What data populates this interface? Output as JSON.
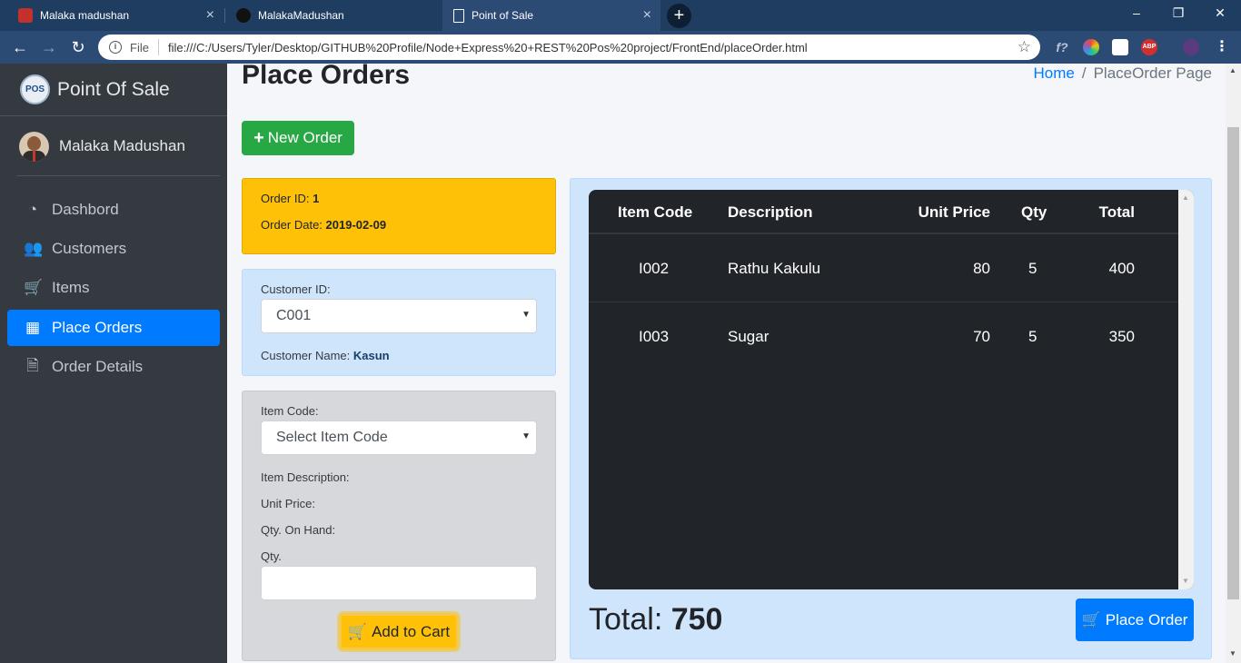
{
  "browser": {
    "tabs": [
      {
        "title": "Malaka madushan",
        "favicon": "red-mascot-icon"
      },
      {
        "title": "MalakaMadushan",
        "favicon": "github-icon"
      },
      {
        "title": "Point of Sale",
        "favicon": "page-icon"
      }
    ],
    "address": {
      "scheme_label": "File",
      "url": "file:///C:/Users/Tyler/Desktop/GITHUB%20Profile/Node+Express%20+REST%20Pos%20project/FrontEnd/placeOrder.html"
    },
    "extensions": [
      "f?",
      "color-wheel-icon",
      "glasses-icon",
      "ABP",
      "profile-avatar"
    ]
  },
  "sidebar": {
    "brand": "Point Of Sale",
    "brand_logo": "POS",
    "user": "Malaka Madushan",
    "items": [
      {
        "label": "Dashbord",
        "icon": "tachometer-icon"
      },
      {
        "label": "Customers",
        "icon": "users-icon"
      },
      {
        "label": "Items",
        "icon": "cart-icon"
      },
      {
        "label": "Place Orders",
        "icon": "grid-icon",
        "active": true
      },
      {
        "label": "Order Details",
        "icon": "document-icon"
      }
    ]
  },
  "header": {
    "title": "Place Orders",
    "breadcrumb": {
      "home": "Home",
      "separator": "/",
      "current": "PlaceOrder Page"
    }
  },
  "new_order_label": "New Order",
  "order": {
    "id_label": "Order ID:",
    "id_value": "1",
    "date_label": "Order Date:",
    "date_value": "2019-02-09"
  },
  "customer": {
    "id_label": "Customer ID:",
    "selected_id": "C001",
    "name_label": "Customer Name:",
    "name_value": "Kasun"
  },
  "item_form": {
    "code_label": "Item Code:",
    "code_placeholder": "Select Item Code",
    "description_label": "Item Description:",
    "unit_price_label": "Unit Price:",
    "qty_on_hand_label": "Qty. On Hand:",
    "qty_label": "Qty.",
    "add_to_cart_label": "Add to Cart"
  },
  "cart": {
    "headers": [
      "Item Code",
      "Description",
      "Unit Price",
      "Qty",
      "Total"
    ],
    "rows": [
      {
        "code": "I002",
        "description": "Rathu Kakulu",
        "unit_price": "80",
        "qty": "5",
        "total": "400"
      },
      {
        "code": "I003",
        "description": "Sugar",
        "unit_price": "70",
        "qty": "5",
        "total": "350"
      }
    ],
    "total_label": "Total:",
    "total_value": "750",
    "place_order_label": "Place Order"
  },
  "colors": {
    "sidebar_bg": "#343a40",
    "active_nav": "#007bff",
    "new_order_btn": "#28a745",
    "order_card": "#ffc107",
    "customer_card": "#cfe5fb",
    "item_card": "#d6d8db",
    "table_bg": "#212529"
  }
}
